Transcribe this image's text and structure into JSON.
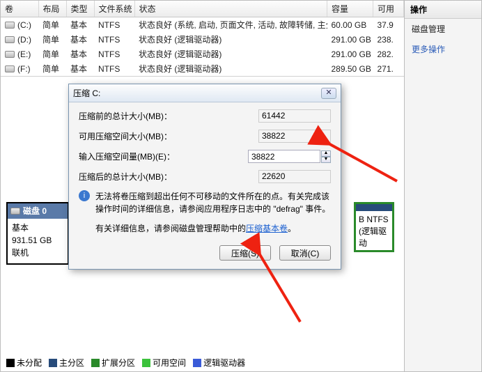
{
  "table": {
    "headers": [
      "卷",
      "布局",
      "类型",
      "文件系统",
      "状态",
      "容量",
      "可用"
    ],
    "rows": [
      {
        "vol": "(C:)",
        "layout": "简单",
        "type": "基本",
        "fs": "NTFS",
        "status": "状态良好 (系统, 启动, 页面文件, 活动, 故障转储, 主分区)",
        "cap": "60.00 GB",
        "free": "37.9"
      },
      {
        "vol": "(D:)",
        "layout": "简单",
        "type": "基本",
        "fs": "NTFS",
        "status": "状态良好 (逻辑驱动器)",
        "cap": "291.00 GB",
        "free": "238."
      },
      {
        "vol": "(E:)",
        "layout": "简单",
        "type": "基本",
        "fs": "NTFS",
        "status": "状态良好 (逻辑驱动器)",
        "cap": "291.00 GB",
        "free": "282."
      },
      {
        "vol": "(F:)",
        "layout": "简单",
        "type": "基本",
        "fs": "NTFS",
        "status": "状态良好 (逻辑驱动器)",
        "cap": "289.50 GB",
        "free": "271."
      }
    ]
  },
  "side": {
    "header": "操作",
    "items": [
      "磁盘管理",
      "更多操作"
    ]
  },
  "diskSummary": {
    "title": "磁盘 0",
    "type": "基本",
    "size": "931.51 GB",
    "state": "联机"
  },
  "diskPart": {
    "fs": "B NTFS",
    "kind": "(逻辑驱动"
  },
  "legend": {
    "items": [
      {
        "color": "#000000",
        "label": "未分配"
      },
      {
        "color": "#274b7a",
        "label": "主分区"
      },
      {
        "color": "#2a8a2a",
        "label": "扩展分区"
      },
      {
        "color": "#3cc23c",
        "label": "可用空间"
      },
      {
        "color": "#3a5bd8",
        "label": "逻辑驱动器"
      }
    ]
  },
  "dialog": {
    "title": "压缩 C:",
    "fields": {
      "before_label": "压缩前的总计大小(MB)：",
      "before_val": "61442",
      "avail_label": "可用压缩空间大小(MB)：",
      "avail_val": "38822",
      "input_label": "输入压缩空间量(MB)(E)：",
      "input_val": "38822",
      "after_label": "压缩后的总计大小(MB)：",
      "after_val": "22620"
    },
    "info": "无法将卷压缩到超出任何不可移动的文件所在的点。有关完成该操作时间的详细信息，请参阅应用程序日志中的 \"defrag\" 事件。",
    "moreinfo_prefix": "有关详细信息，请参阅磁盘管理帮助中的",
    "moreinfo_link": "压缩基本卷",
    "btn_ok": "压缩(S)",
    "btn_cancel": "取消(C)"
  }
}
